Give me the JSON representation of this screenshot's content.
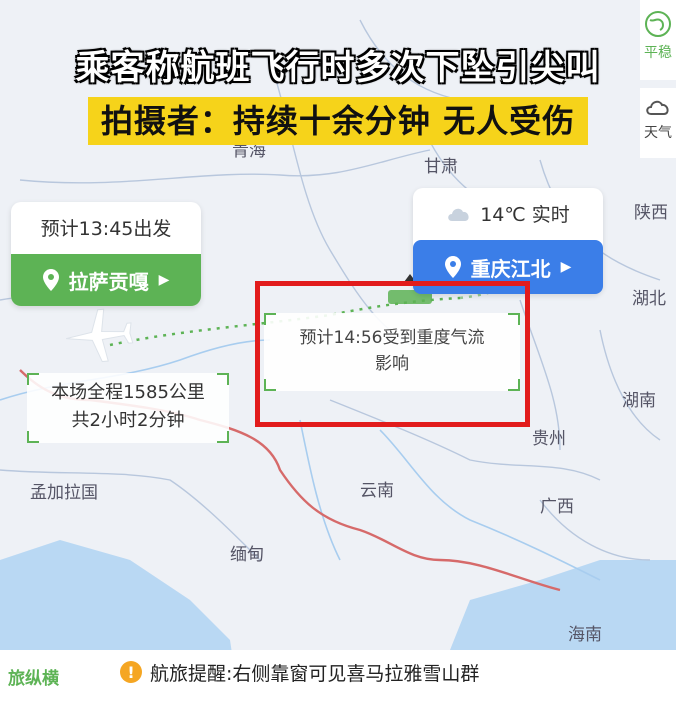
{
  "headline": {
    "line1": "乘客称航班飞行时多次下坠引尖叫",
    "line2": "拍摄者：持续十余分钟 无人受伤"
  },
  "departure": {
    "time_label": "预计13:45出发",
    "airport": "拉萨贡嘎",
    "color": "#5db355"
  },
  "arrival": {
    "weather": "14℃ 实时",
    "airport": "重庆江北",
    "color": "#3b7ee8"
  },
  "route_info": {
    "line1": "本场全程1585公里",
    "line2": "共2小时2分钟"
  },
  "eta": {
    "line1": "预计14:56受到重度气流",
    "line2": "影响"
  },
  "map_labels": {
    "qinghai": "青海",
    "gansu": "甘肃",
    "shanxi": "陕西",
    "hubei": "湖北",
    "hunan": "湖南",
    "guizhou": "贵州",
    "yunnan": "云南",
    "guangxi": "广西",
    "bangladesh": "孟加拉国",
    "myanmar": "缅甸",
    "hainan": "海南"
  },
  "side_panel": {
    "item1": "平稳",
    "item2": "天气"
  },
  "footer": {
    "brand": "旅纵横",
    "notice": "航旅提醒:右侧靠窗可见喜马拉雅雪山群"
  }
}
